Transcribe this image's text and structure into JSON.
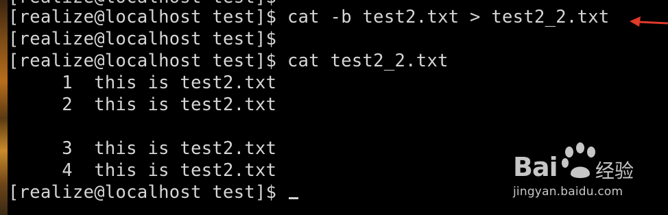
{
  "terminal": {
    "lines": [
      "[realize@localhost test]$ cat -b test2.txt > test2_2.txt",
      "[realize@localhost test]$",
      "[realize@localhost test]$ cat test2_2.txt",
      "     1  this is test2.txt",
      "     2  this is test2.txt",
      "",
      "     3  this is test2.txt",
      "     4  this is test2.txt",
      "[realize@localhost test]$ "
    ]
  },
  "annotation": {
    "arrow_color": "#e03a2a"
  },
  "watermark": {
    "brand": "Bai",
    "brand_suffix": "",
    "chinese": "经验",
    "url": "jingyan.baidu.com"
  },
  "colors": {
    "background": "#000000",
    "text": "#d6d6d6",
    "arrow": "#e03a2a"
  }
}
